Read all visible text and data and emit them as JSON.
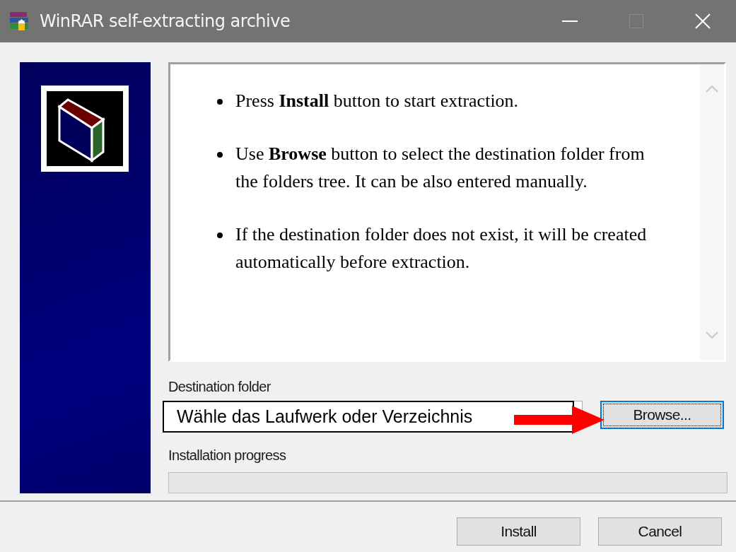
{
  "window": {
    "title": "WinRAR self-extracting archive",
    "maximize_disabled": true
  },
  "instructions": [
    "Press **Install** button to start extraction.",
    "Use **Browse** button to select the destination folder from the folders tree. It can be also entered manually.",
    "If the destination folder does not exist, it will be created automatically before extraction."
  ],
  "destination": {
    "label": "Destination folder",
    "button": "Browse..."
  },
  "progress": {
    "label": "Installation progress",
    "level": 0
  },
  "buttons": [
    "Install",
    "Cancel"
  ],
  "annotation": {
    "text": "Wähle das Laufwerk oder Verzeichnis"
  }
}
